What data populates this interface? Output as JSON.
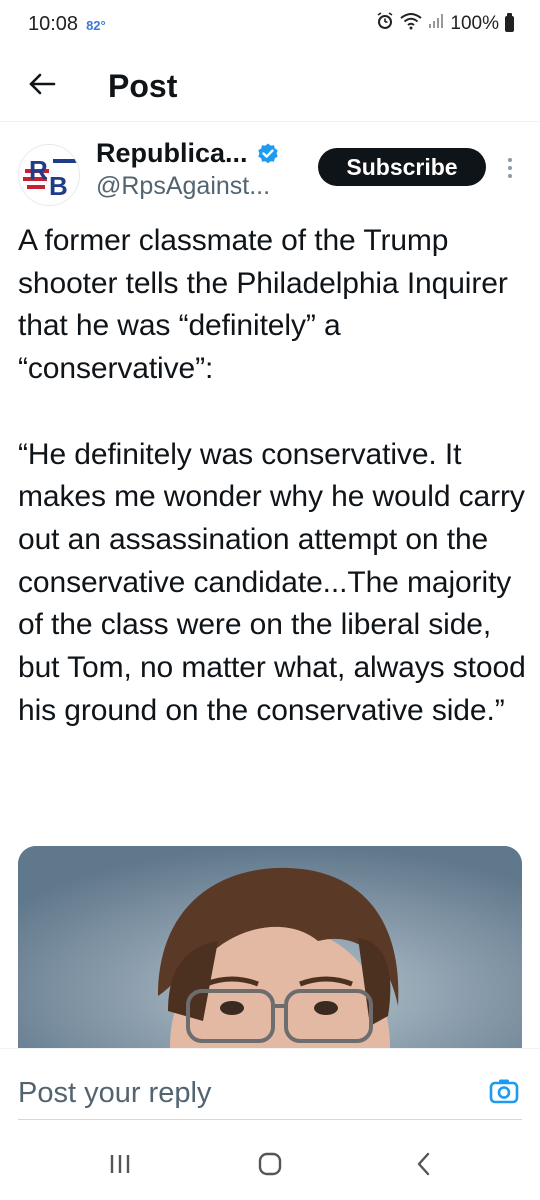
{
  "status_bar": {
    "time": "10:08",
    "temperature": "82°",
    "battery": "100%"
  },
  "header": {
    "title": "Post",
    "back_icon": "arrow-left-icon"
  },
  "author": {
    "name": "Republica...",
    "handle": "@RpsAgainst...",
    "verified": true,
    "avatar_text": "RB",
    "subscribe_label": "Subscribe",
    "more_icon": "more-vertical-icon"
  },
  "tweet": {
    "text": "A former classmate of the Trump shooter tells the Philadelphia Inquirer that he was “definitely” a “conservative”:\n\n“He definitely was conservative. It makes me wonder why he would carry out an assassination attempt on the conservative candidate...The majority of the class were on the liberal side, but Tom, no matter what, always stood his ground on the conservative side.”"
  },
  "reply": {
    "placeholder": "Post your reply",
    "camera_icon": "camera-icon"
  },
  "nav": {
    "recents_icon": "recents-icon",
    "home_icon": "home-icon",
    "back_icon": "back-chevron-icon"
  },
  "colors": {
    "accent": "#1d9bf0",
    "text": "#0f1419",
    "secondary_text": "#536471",
    "subscribe_bg": "#0f1419"
  }
}
